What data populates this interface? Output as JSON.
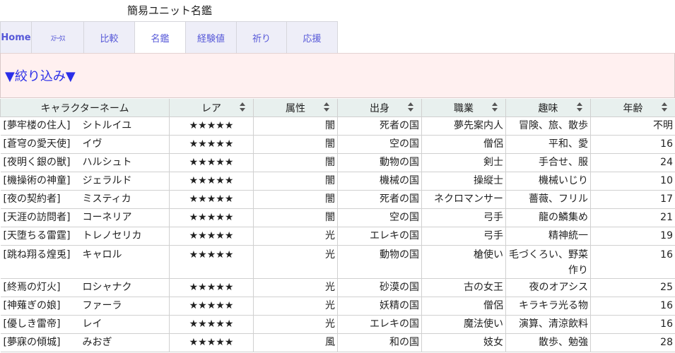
{
  "page_title": "簡易ユニット名鑑",
  "tabs": [
    {
      "label": "Home"
    },
    {
      "label": "ｽﾃｰﾀｽ"
    },
    {
      "label": "比較"
    },
    {
      "label": "名鑑"
    },
    {
      "label": "経験値"
    },
    {
      "label": "祈り"
    },
    {
      "label": "応援"
    }
  ],
  "filter": {
    "label": "▼絞り込み▼"
  },
  "table": {
    "headers": [
      "キャラクターネーム",
      "レア",
      "属性",
      "出身",
      "職業",
      "趣味",
      "年齢"
    ],
    "rows": [
      {
        "title": "[夢牢楼の住人]",
        "name": "シトルイユ",
        "rare": "★★★★★",
        "element": "闇",
        "origin": "死者の国",
        "job": "夢先案内人",
        "hobby": "冒険、旅、散歩",
        "age": "不明"
      },
      {
        "title": "[蒼穹の愛天使]",
        "name": "イヴ",
        "rare": "★★★★★",
        "element": "闇",
        "origin": "空の国",
        "job": "僧侶",
        "hobby": "平和、愛",
        "age": "16"
      },
      {
        "title": "[夜明く銀の獣]",
        "name": "ハルシュト",
        "rare": "★★★★★",
        "element": "闇",
        "origin": "動物の国",
        "job": "剣士",
        "hobby": "手合せ、服",
        "age": "24"
      },
      {
        "title": "[機操術の神童]",
        "name": "ジェラルド",
        "rare": "★★★★★",
        "element": "闇",
        "origin": "機械の国",
        "job": "操縦士",
        "hobby": "機械いじり",
        "age": "10"
      },
      {
        "title": "[夜の契約者]",
        "name": "ミスティカ",
        "rare": "★★★★★",
        "element": "闇",
        "origin": "死者の国",
        "job": "ネクロマンサー",
        "hobby": "薔薇、フリル",
        "age": "17"
      },
      {
        "title": "[天涯の訪問者]",
        "name": "コーネリア",
        "rare": "★★★★★",
        "element": "闇",
        "origin": "空の国",
        "job": "弓手",
        "hobby": "龍の鱗集め",
        "age": "21"
      },
      {
        "title": "[天堕ちる雷霆]",
        "name": "トレノセリカ",
        "rare": "★★★★★",
        "element": "光",
        "origin": "エレキの国",
        "job": "弓手",
        "hobby": "精神統一",
        "age": "19"
      },
      {
        "title": "[跳ね翔る煌兎]",
        "name": "キャロル",
        "rare": "★★★★★",
        "element": "光",
        "origin": "動物の国",
        "job": "槍使い",
        "hobby": "毛づくろい、野菜作り",
        "age": "16"
      },
      {
        "title": "[終焉の灯火]",
        "name": "ロシャナク",
        "rare": "★★★★★",
        "element": "光",
        "origin": "砂漠の国",
        "job": "古の女王",
        "hobby": "夜のオアシス",
        "age": "25"
      },
      {
        "title": "[神薙ぎの娘]",
        "name": "ファーラ",
        "rare": "★★★★★",
        "element": "光",
        "origin": "妖精の国",
        "job": "僧侶",
        "hobby": "キラキラ光る物",
        "age": "16"
      },
      {
        "title": "[優しき雷帝]",
        "name": "レイ",
        "rare": "★★★★★",
        "element": "光",
        "origin": "エレキの国",
        "job": "魔法使い",
        "hobby": "演算、清涼飲料",
        "age": "16"
      },
      {
        "title": "[夢寐の傾城]",
        "name": "みおぎ",
        "rare": "★★★★★",
        "element": "風",
        "origin": "和の国",
        "job": "妓女",
        "hobby": "散歩、勉強",
        "age": "28"
      }
    ]
  }
}
